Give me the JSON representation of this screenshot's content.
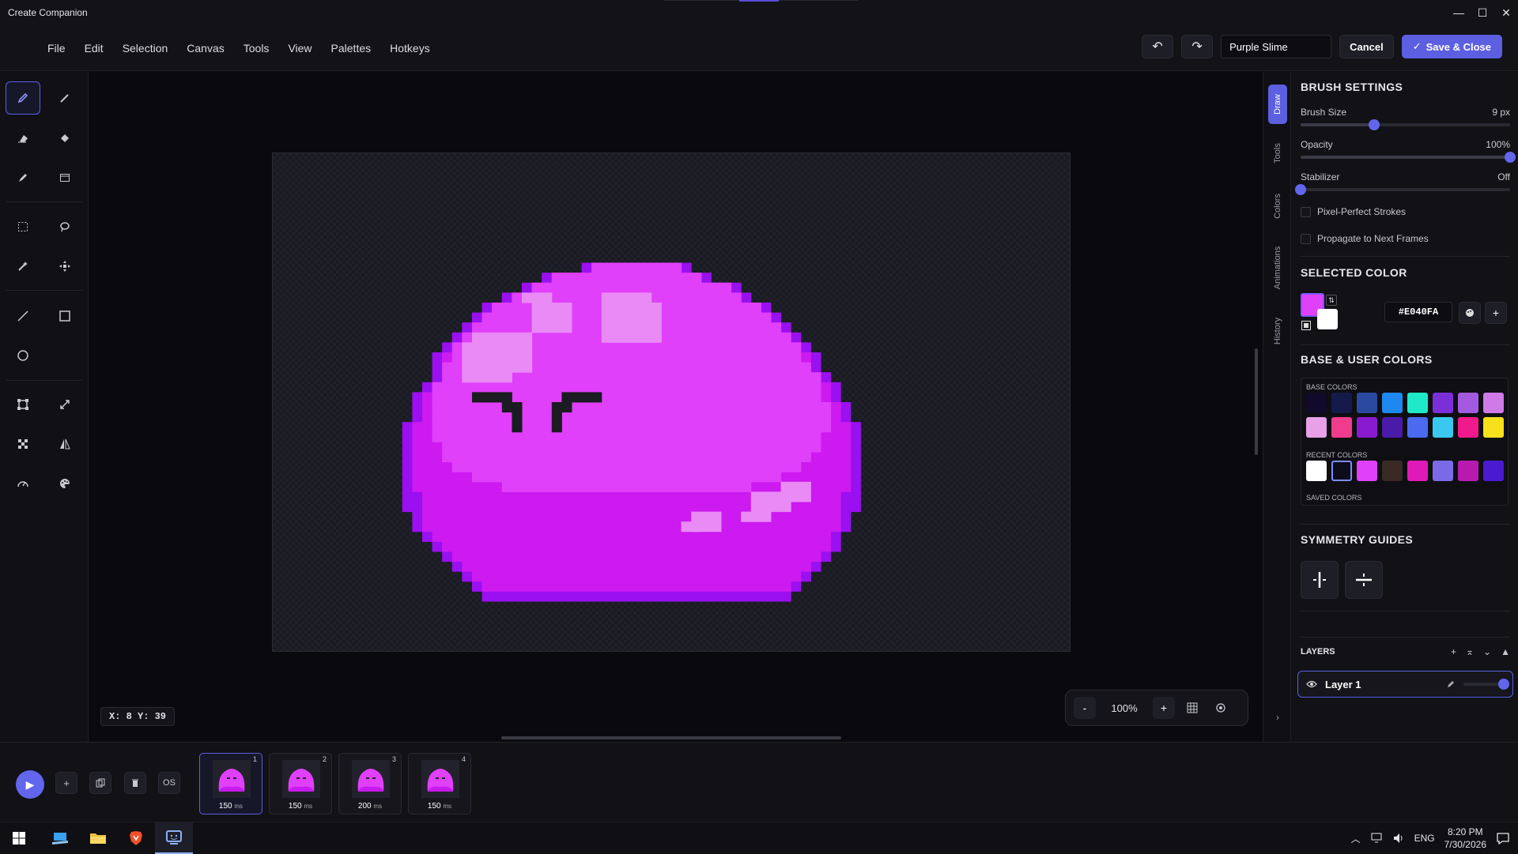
{
  "window": {
    "title": "Create Companion",
    "controls": [
      "—",
      "☐",
      "✕"
    ]
  },
  "menu": [
    "File",
    "Edit",
    "Selection",
    "Canvas",
    "Tools",
    "View",
    "Palettes",
    "Hotkeys"
  ],
  "header": {
    "undo": "↶",
    "redo": "↷",
    "name_value": "Purple Slime",
    "cancel": "Cancel",
    "save": "Save & Close",
    "save_icon": "✓"
  },
  "canvas": {
    "coords": "X: 8 Y: 39",
    "zoom": "100%",
    "zoom_out": "-",
    "zoom_in": "+"
  },
  "side_tabs": [
    "Draw",
    "Tools",
    "Colors",
    "Animations",
    "History"
  ],
  "brush": {
    "heading": "BRUSH SETTINGS",
    "size_label": "Brush Size",
    "size_value": "9 px",
    "size_level": 0.35,
    "opacity_label": "Opacity",
    "opacity_value": "100%",
    "opacity_level": 1.0,
    "stabilizer_label": "Stabilizer",
    "stabilizer_value": "Off",
    "stabilizer_level": 0.0,
    "pixel_perfect": "Pixel-Perfect Strokes",
    "propagate": "Propagate to Next Frames"
  },
  "selected_color": {
    "heading": "SELECTED COLOR",
    "primary": "#E040FA",
    "secondary": "#FFFFFF",
    "hex": "#E040FA"
  },
  "colors": {
    "heading": "BASE & USER COLORS",
    "base_label": "BASE COLORS",
    "base": [
      "#120a2a",
      "#141a4a",
      "#2a4aa0",
      "#1e88f0",
      "#1de9c8",
      "#7b2fd8",
      "#a45ae0",
      "#d07ae8",
      "#e8a0e8",
      "#f03c8c",
      "#8a1ad0",
      "#4a1aa8",
      "#4a6af0",
      "#3ac8f0",
      "#f01a8c",
      "#f8e01a"
    ],
    "recent_label": "RECENT COLORS",
    "recent": [
      "#ffffff",
      "#0c0c1a",
      "#e040fa",
      "#3a2a24",
      "#e01ab8",
      "#7a6ae8",
      "#b81ab0",
      "#4a1ad0"
    ],
    "saved_label": "SAVED COLORS"
  },
  "symmetry": {
    "heading": "SYMMETRY GUIDES"
  },
  "layers": {
    "heading": "LAYERS",
    "items": [
      {
        "name": "Layer 1"
      }
    ]
  },
  "timeline": {
    "frames": [
      {
        "num": "1",
        "ms": "150",
        "unit": "ms"
      },
      {
        "num": "2",
        "ms": "150",
        "unit": "ms"
      },
      {
        "num": "3",
        "ms": "200",
        "unit": "ms"
      },
      {
        "num": "4",
        "ms": "150",
        "unit": "ms"
      }
    ],
    "onion_skin": "OS"
  },
  "taskbar": {
    "lang": "ENG",
    "time": "8:20 PM",
    "date": "7/30/2026"
  },
  "colors_theme": {
    "accent": "#5b5fe0",
    "slime_dark": "#9a10f0",
    "slime_mid": "#cc1af0",
    "slime_main": "#e040fa",
    "slime_light": "#e98af5"
  }
}
